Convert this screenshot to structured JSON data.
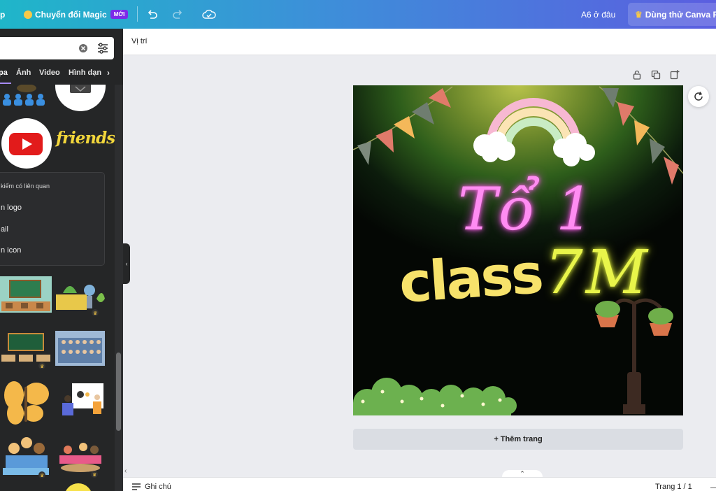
{
  "topbar": {
    "back_fragment": "p",
    "magic_label": "Chuyển đổi Magic",
    "magic_badge": "MỚI",
    "location": "A6 ở đâu",
    "try_pro": "Dùng thử Canva Pr"
  },
  "sidebar": {
    "tabs": [
      "pa",
      "Ảnh",
      "Video",
      "Hình dạn"
    ],
    "sticker_text": "friends",
    "suggestions": {
      "title": "kiếm có liên quan",
      "items": [
        "n logo",
        "ail",
        "n icon"
      ]
    }
  },
  "position_bar": {
    "label": "Vị trí"
  },
  "canvas": {
    "line1": "Tổ 1",
    "line2_left": "class",
    "line2_right": "7M"
  },
  "add_page_label": "+ Thêm trang",
  "bottombar": {
    "notes": "Ghi chú",
    "page_indicator": "Trang 1 / 1"
  },
  "colors": {
    "topbar_start": "#1fb6c9",
    "topbar_end": "#5b5ee0",
    "sidebar_bg": "#252627",
    "neon_pink": "#ff8cf2",
    "neon_yellow": "#e9f54a",
    "text_yellow": "#f7e26b"
  }
}
